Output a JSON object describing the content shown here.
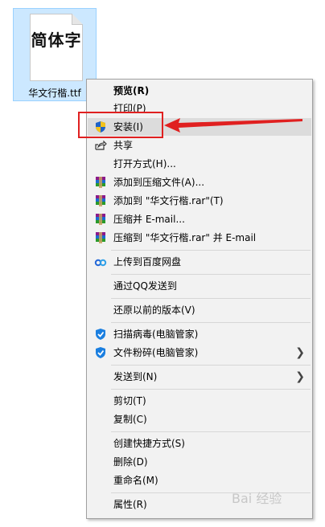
{
  "desktop": {
    "file": {
      "name": "华文行楷.ttf",
      "preview": "简体字"
    }
  },
  "context_menu": {
    "items": [
      {
        "label": "预览(R)",
        "icon": null
      },
      {
        "label": "打印(P)",
        "icon": null
      },
      {
        "label": "安装(I)",
        "icon": "uac-shield-icon"
      },
      {
        "label": "共享",
        "icon": "share-icon"
      },
      {
        "label": "打开方式(H)...",
        "icon": null
      },
      {
        "label": "添加到压缩文件(A)...",
        "icon": "winrar-icon"
      },
      {
        "label": "添加到 \"华文行楷.rar\"(T)",
        "icon": "winrar-icon"
      },
      {
        "label": "压缩并 E-mail...",
        "icon": "winrar-icon"
      },
      {
        "label": "压缩到 \"华文行楷.rar\" 并 E-mail",
        "icon": "winrar-icon"
      },
      {
        "label": "上传到百度网盘",
        "icon": "baidu-netdisk-icon"
      },
      {
        "label": "通过QQ发送到",
        "icon": null
      },
      {
        "label": "还原以前的版本(V)",
        "icon": null
      },
      {
        "label": "扫描病毒(电脑管家)",
        "icon": "tencent-pcmgr-icon"
      },
      {
        "label": "文件粉碎(电脑管家)",
        "icon": "tencent-pcmgr-icon",
        "submenu": true
      },
      {
        "label": "发送到(N)",
        "icon": null,
        "submenu": true
      },
      {
        "label": "剪切(T)",
        "icon": null
      },
      {
        "label": "复制(C)",
        "icon": null
      },
      {
        "label": "创建快捷方式(S)",
        "icon": null
      },
      {
        "label": "删除(D)",
        "icon": null
      },
      {
        "label": "重命名(M)",
        "icon": null
      },
      {
        "label": "属性(R)",
        "icon": null
      }
    ],
    "highlighted_item": "安装(I)"
  },
  "colors": {
    "menu_bg": "#f2f2f2",
    "highlight": "#dcdcdc",
    "selection_bg": "#cce8ff",
    "annotation": "#e02020"
  },
  "watermark": "Bai 经验"
}
